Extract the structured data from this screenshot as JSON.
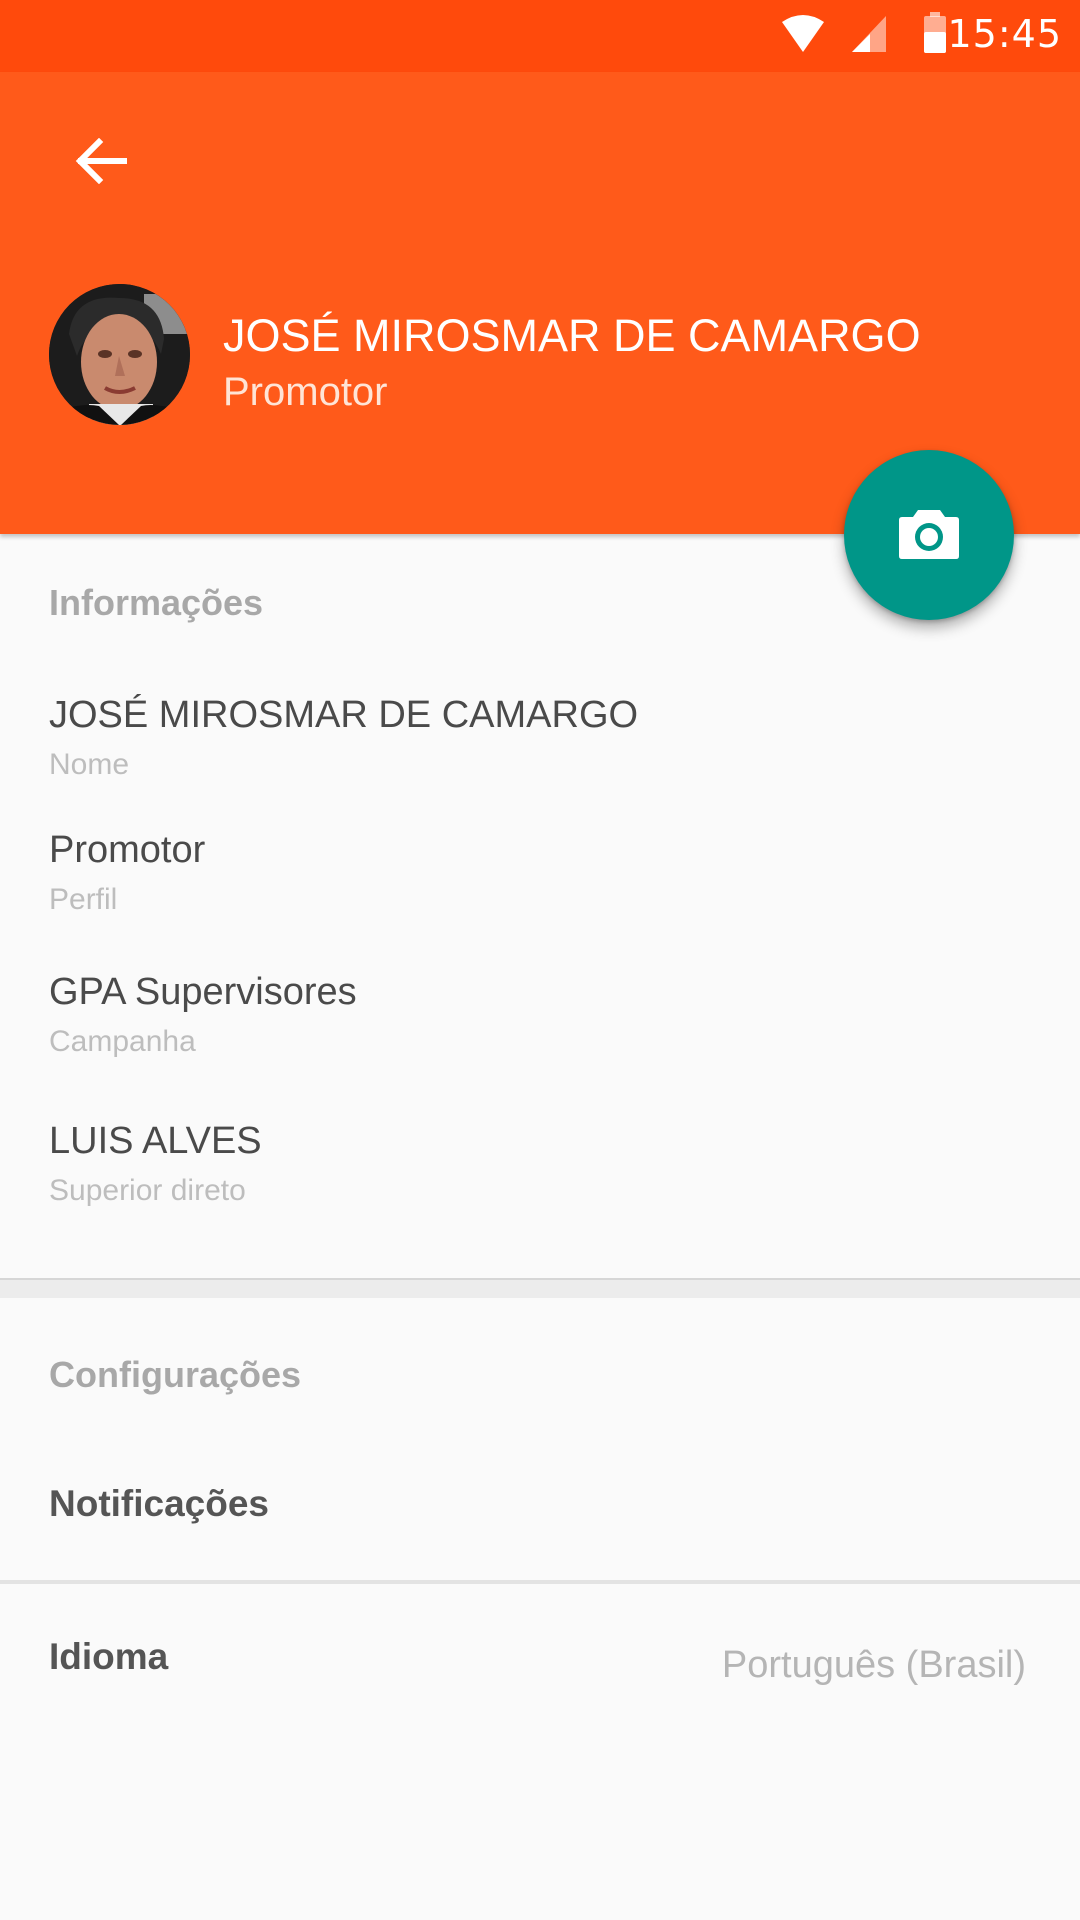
{
  "status_bar": {
    "time": "15:45",
    "icons": [
      "wifi-icon",
      "signal-icon",
      "battery-icon"
    ]
  },
  "header": {
    "back_icon": "arrow-left-icon",
    "name": "JOSÉ MIROSMAR DE CAMARGO",
    "role": "Promotor",
    "fab_icon": "camera-icon"
  },
  "info_section": {
    "title": "Informações",
    "items": [
      {
        "value": "JOSÉ MIROSMAR DE CAMARGO",
        "label": "Nome"
      },
      {
        "value": "Promotor",
        "label": "Perfil"
      },
      {
        "value": "GPA Supervisores",
        "label": "Campanha"
      },
      {
        "value": "LUIS ALVES",
        "label": "Superior direto"
      }
    ]
  },
  "settings_section": {
    "title": "Configurações",
    "notifications_label": "Notificações",
    "language_label": "Idioma",
    "language_value": "Português (Brasil)"
  },
  "colors": {
    "status_bar": "#ff4a0c",
    "app_bar": "#ff5a1a",
    "fab": "#009688",
    "background": "#fafafa"
  }
}
